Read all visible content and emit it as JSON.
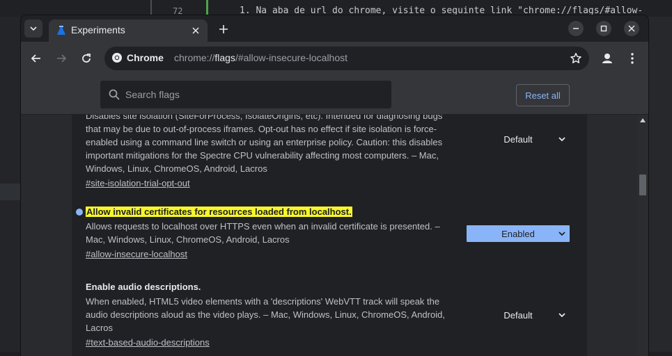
{
  "editor": {
    "line_number": "72",
    "code_line": "1. Na aba de url do chrome, visite o seguinte link \"chrome://flags/#allow-"
  },
  "tab": {
    "title": "Experiments"
  },
  "omnibox": {
    "chip_label": "Chrome",
    "url_prefix": "chrome://",
    "url_host": "flags",
    "url_rest": "/#allow-insecure-localhost"
  },
  "flags": {
    "search_placeholder": "Search flags",
    "reset_label": "Reset all",
    "experiments": [
      {
        "name": "",
        "partial_top": "Disables site isolation (SiteForProcess, IsolateOrigins, etc). Intended for diagnosing bugs",
        "description": "that may be due to out-of-process iframes. Opt-out has no effect if site isolation is force-enabled using a command line switch or using an enterprise policy. Caution: this disables important mitigations for the Spectre CPU vulnerability affecting most computers. – Mac, Windows, Linux, ChromeOS, Android, Lacros",
        "permalink": "#site-isolation-trial-opt-out",
        "value": "Default"
      },
      {
        "name": "Allow invalid certificates for resources loaded from localhost.",
        "description": "Allows requests to localhost over HTTPS even when an invalid certificate is presented. – Mac, Windows, Linux, ChromeOS, Android, Lacros",
        "permalink": "#allow-insecure-localhost",
        "value": "Enabled"
      },
      {
        "name": "Enable audio descriptions.",
        "description": "When enabled, HTML5 video elements with a 'descriptions' WebVTT track will speak the audio descriptions aloud as the video plays. – Mac, Windows, Linux, ChromeOS, Android, Lacros",
        "permalink": "#text-based-audio-descriptions",
        "value": "Default"
      }
    ]
  },
  "colors": {
    "accent": "#8ab4f8",
    "highlight": "#f6f62b",
    "background": "#202124"
  }
}
